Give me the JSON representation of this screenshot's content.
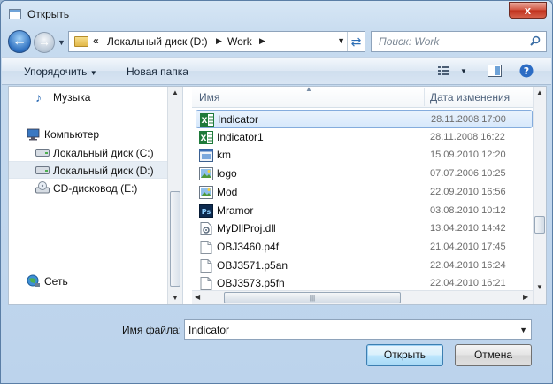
{
  "window": {
    "title": "Открыть",
    "close_glyph": "x"
  },
  "nav": {
    "address": {
      "chevron": "«",
      "segments": [
        "Локальный диск (D:)",
        "Work"
      ]
    },
    "search_placeholder": "Поиск: Work"
  },
  "toolbar": {
    "organize": "Упорядочить",
    "new_folder": "Новая папка"
  },
  "sidebar": {
    "items": [
      {
        "label": "Музыка",
        "icon": "music-icon"
      },
      {
        "label": "Компьютер",
        "icon": "computer-icon"
      },
      {
        "label": "Локальный диск (C:)",
        "icon": "drive-icon"
      },
      {
        "label": "Локальный диск (D:)",
        "icon": "drive-icon",
        "selected": true
      },
      {
        "label": "CD-дисковод (E:)",
        "icon": "cd-drive-icon"
      },
      {
        "label": "Сеть",
        "icon": "network-icon"
      }
    ]
  },
  "files": {
    "columns": {
      "name": "Имя",
      "date": "Дата изменения"
    },
    "rows": [
      {
        "name": "Indicator",
        "date": "28.11.2008 17:00",
        "icon": "excel-icon",
        "selected": true
      },
      {
        "name": "Indicator1",
        "date": "28.11.2008 16:22",
        "icon": "excel-icon"
      },
      {
        "name": "km",
        "date": "15.09.2010 12:20",
        "icon": "program-icon"
      },
      {
        "name": "logo",
        "date": "07.07.2006 10:25",
        "icon": "image-icon"
      },
      {
        "name": "Mod",
        "date": "22.09.2010 16:56",
        "icon": "image-icon"
      },
      {
        "name": "Mramor",
        "date": "03.08.2010 10:12",
        "icon": "photoshop-icon"
      },
      {
        "name": "MyDllProj.dll",
        "date": "13.04.2010 14:42",
        "icon": "dll-icon"
      },
      {
        "name": "OBJ3460.p4f",
        "date": "21.04.2010 17:45",
        "icon": "file-icon"
      },
      {
        "name": "OBJ3571.p5an",
        "date": "22.04.2010 16:24",
        "icon": "file-icon"
      },
      {
        "name": "OBJ3573.p5fn",
        "date": "22.04.2010 16:21",
        "icon": "file-icon"
      }
    ]
  },
  "bottom": {
    "filename_label": "Имя файла:",
    "filename_value": "Indicator",
    "open_button": "Открыть",
    "cancel_button": "Отмена"
  },
  "colors": {
    "selection": "#d6e8fb",
    "accent": "#2d6fbf"
  }
}
